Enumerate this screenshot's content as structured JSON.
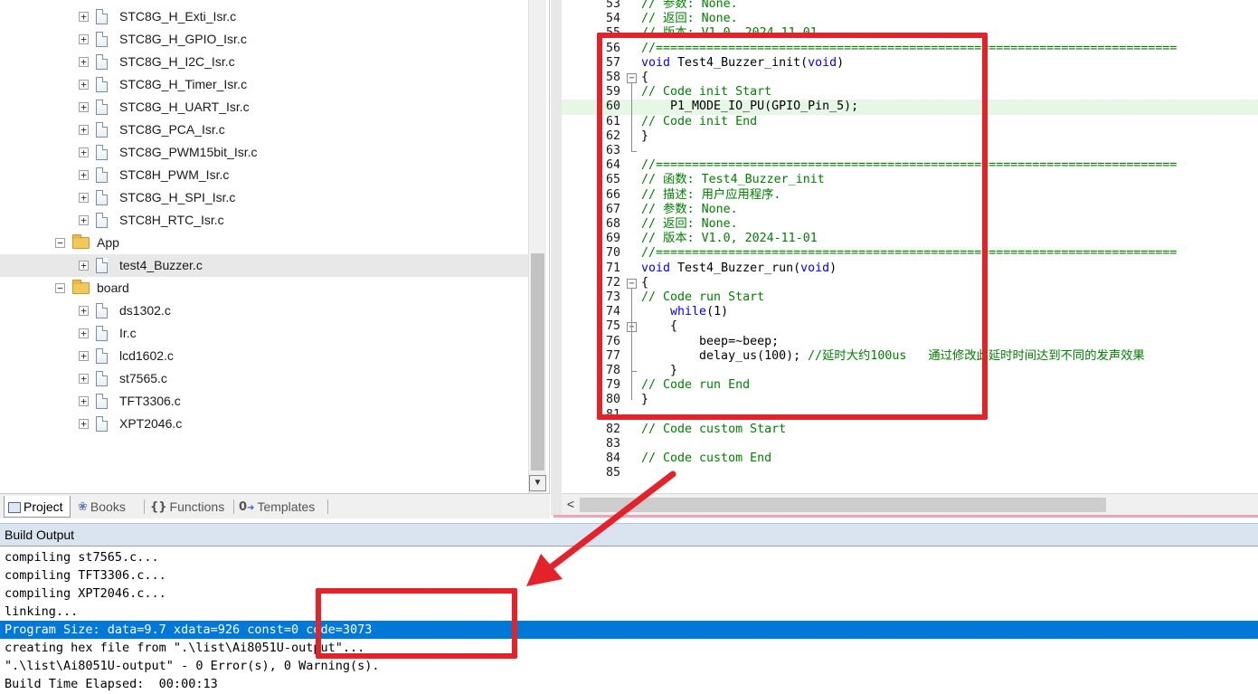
{
  "project_tree": {
    "items": [
      {
        "label": "STC8G_H_Exti_Isr.c",
        "type": "file",
        "level": 2
      },
      {
        "label": "STC8G_H_GPIO_Isr.c",
        "type": "file",
        "level": 2
      },
      {
        "label": "STC8G_H_I2C_Isr.c",
        "type": "file",
        "level": 2
      },
      {
        "label": "STC8G_H_Timer_Isr.c",
        "type": "file",
        "level": 2
      },
      {
        "label": "STC8G_H_UART_Isr.c",
        "type": "file",
        "level": 2
      },
      {
        "label": "STC8G_PCA_Isr.c",
        "type": "file",
        "level": 2
      },
      {
        "label": "STC8G_PWM15bit_Isr.c",
        "type": "file",
        "level": 2
      },
      {
        "label": "STC8H_PWM_Isr.c",
        "type": "file",
        "level": 2
      },
      {
        "label": "STC8G_H_SPI_Isr.c",
        "type": "file",
        "level": 2
      },
      {
        "label": "STC8H_RTC_Isr.c",
        "type": "file",
        "level": 2
      },
      {
        "label": "App",
        "type": "folder",
        "level": 1
      },
      {
        "label": "test4_Buzzer.c",
        "type": "file",
        "level": 2,
        "selected": true
      },
      {
        "label": "board",
        "type": "folder",
        "level": 1
      },
      {
        "label": "ds1302.c",
        "type": "file",
        "level": 2
      },
      {
        "label": "Ir.c",
        "type": "file",
        "level": 2
      },
      {
        "label": "lcd1602.c",
        "type": "file",
        "level": 2
      },
      {
        "label": "st7565.c",
        "type": "file",
        "level": 2
      },
      {
        "label": "TFT3306.c",
        "type": "file",
        "level": 2
      },
      {
        "label": "XPT2046.c",
        "type": "file",
        "level": 2
      }
    ]
  },
  "panel_tabs": [
    {
      "label": "Project",
      "icon": "project-icon",
      "active": true
    },
    {
      "label": "Books",
      "icon": "books-icon"
    },
    {
      "label": "Functions",
      "icon": "functions-icon"
    },
    {
      "label": "Templates",
      "icon": "templates-icon"
    }
  ],
  "editor": {
    "lines": [
      {
        "n": "53",
        "text": "// 参数: None.",
        "kind": "cmt"
      },
      {
        "n": "54",
        "text": "// 返回: None.",
        "kind": "cmt"
      },
      {
        "n": "55",
        "text": "// 版本: V1.0, 2024-11-01",
        "kind": "cmt"
      },
      {
        "n": "56",
        "text": "//========================================================================",
        "kind": "cmt"
      },
      {
        "n": "57",
        "pre": "void ",
        "mid": "Test4_Buzzer_init(",
        "kw2": "void",
        "post": ")",
        "kind": "fn"
      },
      {
        "n": "58",
        "text": "{",
        "kind": "txt",
        "fold": "open"
      },
      {
        "n": "59",
        "text": "// Code init Start",
        "kind": "cmt"
      },
      {
        "n": "60",
        "text": "    P1_MODE_IO_PU(GPIO_Pin_5);",
        "kind": "txt",
        "hl": true
      },
      {
        "n": "61",
        "text": "// Code init End",
        "kind": "cmt"
      },
      {
        "n": "62",
        "text": "}",
        "kind": "txt"
      },
      {
        "n": "63",
        "text": "",
        "kind": "txt",
        "fold": "end"
      },
      {
        "n": "64",
        "text": "//========================================================================",
        "kind": "cmt"
      },
      {
        "n": "65",
        "text": "// 函数: Test4_Buzzer_init",
        "kind": "cmt"
      },
      {
        "n": "66",
        "text": "// 描述: 用户应用程序.",
        "kind": "cmt"
      },
      {
        "n": "67",
        "text": "// 参数: None.",
        "kind": "cmt"
      },
      {
        "n": "68",
        "text": "// 返回: None.",
        "kind": "cmt"
      },
      {
        "n": "69",
        "text": "// 版本: V1.0, 2024-11-01",
        "kind": "cmt"
      },
      {
        "n": "70",
        "text": "//========================================================================",
        "kind": "cmt"
      },
      {
        "n": "71",
        "pre": "void ",
        "mid": "Test4_Buzzer_run(",
        "kw2": "void",
        "post": ")",
        "kind": "fn"
      },
      {
        "n": "72",
        "text": "{",
        "kind": "txt",
        "fold": "open"
      },
      {
        "n": "73",
        "text": "// Code run Start",
        "kind": "cmt"
      },
      {
        "n": "74",
        "pre": "    ",
        "kwa": "while",
        "post2": "(1)",
        "kind": "while"
      },
      {
        "n": "75",
        "text": "    {",
        "kind": "txt",
        "fold": "open"
      },
      {
        "n": "76",
        "text": "        beep=~beep;",
        "kind": "txt"
      },
      {
        "n": "77",
        "pre": "        delay_us(100); ",
        "cmt": "//延时大约100us   通过修改此延时时间达到不同的发声效果",
        "kind": "mixed"
      },
      {
        "n": "78",
        "text": "    }",
        "kind": "txt",
        "fold": "end"
      },
      {
        "n": "79",
        "text": "// Code run End",
        "kind": "cmt"
      },
      {
        "n": "80",
        "text": "}",
        "kind": "txt"
      },
      {
        "n": "81",
        "text": "",
        "kind": "txt"
      },
      {
        "n": "82",
        "text": "// Code custom Start",
        "kind": "cmt"
      },
      {
        "n": "83",
        "text": "",
        "kind": "txt"
      },
      {
        "n": "84",
        "text": "// Code custom End",
        "kind": "cmt"
      },
      {
        "n": "85",
        "text": "",
        "kind": "txt"
      }
    ]
  },
  "build_output": {
    "title": "Build Output",
    "lines": [
      {
        "text": "compiling st7565.c..."
      },
      {
        "text": "compiling TFT3306.c..."
      },
      {
        "text": "compiling XPT2046.c..."
      },
      {
        "text": "linking..."
      },
      {
        "text": "Program Size: data=9.7 xdata=926 const=0 code=3073",
        "selected": true
      },
      {
        "text": "creating hex file from \".\\list\\Ai8051U-output\"..."
      },
      {
        "text": "\".\\list\\Ai8051U-output\" - 0 Error(s), 0 Warning(s)."
      },
      {
        "text": "Build Time Elapsed:  00:00:13"
      }
    ]
  },
  "colors": {
    "annotation": "#e3222a",
    "selection": "#0078d7",
    "comment": "#008000",
    "keyword": "#0000ff"
  }
}
